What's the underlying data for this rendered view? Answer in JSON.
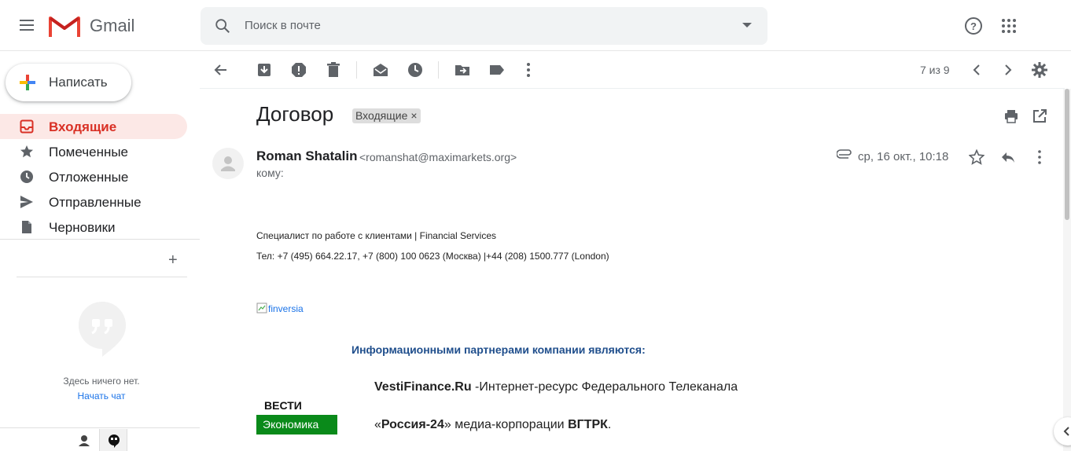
{
  "header": {
    "brand": "Gmail",
    "search_placeholder": "Поиск в почте"
  },
  "compose": {
    "label": "Написать"
  },
  "sidebar": {
    "items": [
      {
        "label": "Входящие",
        "icon": "inbox-icon",
        "active": true
      },
      {
        "label": "Помеченные",
        "icon": "star-icon",
        "active": false
      },
      {
        "label": "Отложенные",
        "icon": "clock-icon",
        "active": false
      },
      {
        "label": "Отправленные",
        "icon": "send-icon",
        "active": false
      },
      {
        "label": "Черновики",
        "icon": "draft-icon",
        "active": false
      }
    ],
    "hangouts": {
      "empty_text": "Здесь ничего нет.",
      "start_chat": "Начать чат"
    }
  },
  "toolbar": {
    "count": "7 из 9"
  },
  "message": {
    "subject": "Договор",
    "label": "Входящие",
    "label_close": "×",
    "sender_name": "Roman Shatalin",
    "sender_email": "<romanshat@maximarkets.org>",
    "to": "кому:",
    "date": "ср, 16 окт., 10:18",
    "body": {
      "line1": "Специалист по работе с клиентами | Financial Services",
      "line2": "Тел: +7 (495) 664.22.17, +7 (800) 100 0623 (Москва) |+44 (208) 1500.777 (London)",
      "image_alt": "finversia",
      "partners_heading": "Информационными партнерами компании являются:",
      "vesti_top": "ВЕСТИ",
      "vesti_bottom": "Экономика",
      "p1_bold": "VestiFinance.Ru",
      "p1_rest": " -Интернет-ресурс Федерального Телеканала",
      "p2_open": "«",
      "p2_bold": "Россия-24",
      "p2_mid": "» медиа-корпорации ",
      "p2_bold2": "ВГТРК",
      "p2_end": "."
    }
  },
  "colors": {
    "active_bg": "#fce8e6",
    "active_text": "#d93025",
    "link": "#1a73e8",
    "partners": "#1f4e8c",
    "vesti_green": "#0a8a1a"
  }
}
